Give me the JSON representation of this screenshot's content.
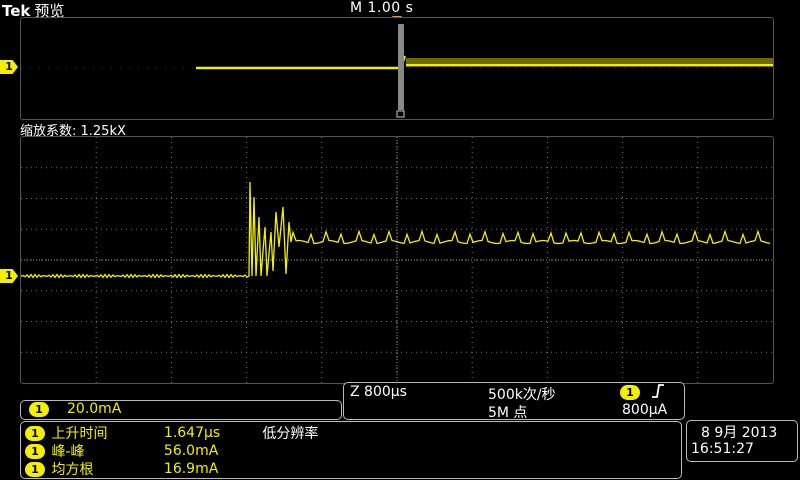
{
  "header": {
    "brand": "Tek",
    "mode": "预览",
    "timebase": "M 1.00 s"
  },
  "overview": {
    "channel_marker": "1"
  },
  "zoom": {
    "label": "缩放系数: 1.25kX",
    "channel_marker": "1"
  },
  "channel_scale": {
    "channel": "1",
    "value": "20.0mA"
  },
  "acquisition": {
    "zoom_time": "Z 800µs",
    "sample_rate": "500k次/秒",
    "record_length": "5M 点",
    "trigger_channel": "1",
    "trigger_slope_icon": "rising-edge-icon",
    "trigger_level": "800µA"
  },
  "measurements": {
    "note": "低分辨率",
    "items": [
      {
        "channel": "1",
        "name": "上升时间",
        "value": "1.647µs"
      },
      {
        "channel": "1",
        "name": "峰-峰",
        "value": "56.0mA"
      },
      {
        "channel": "1",
        "name": "均方根",
        "value": "16.9mA"
      }
    ]
  },
  "datetime": {
    "date": "8 9月 2013",
    "time": "16:51:27"
  },
  "colors": {
    "trace": "#f4ef00",
    "trigger": "#f39c12",
    "grid": "#777777"
  }
}
